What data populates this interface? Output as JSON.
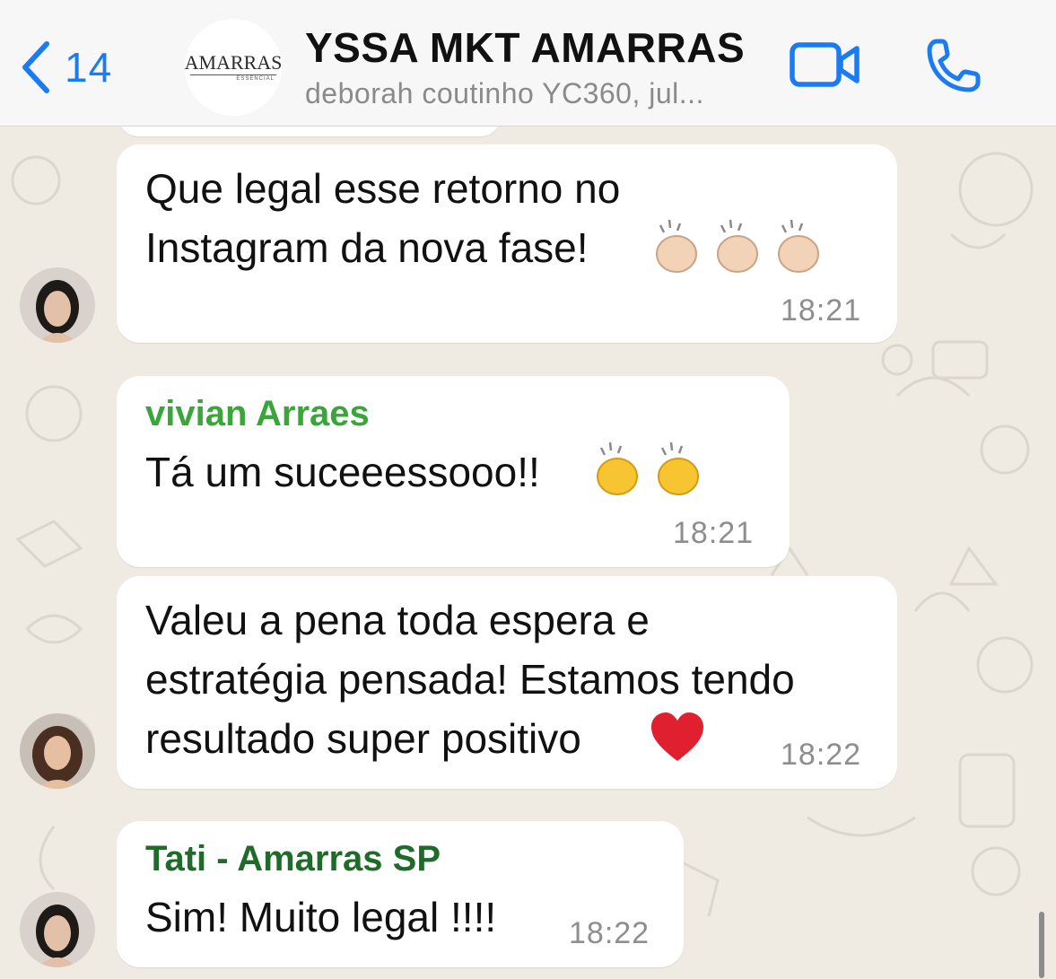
{
  "header": {
    "back_count": "14",
    "group_logo_text": "AMARRAS",
    "group_logo_subtext": "ESSENCIAL",
    "title": "YSSA MKT AMARRAS",
    "subtitle": "deborah coutinho YC360, jul...",
    "icons": {
      "back": "chevron-left-icon",
      "video": "video-camera-icon",
      "call": "phone-icon"
    },
    "accent_color": "#1a7cf0"
  },
  "messages": [
    {
      "sender": "",
      "lines": [
        "Que legal esse retorno no",
        "Instagram da nova fase!"
      ],
      "emoji": "clapping-hands-light-skin x3",
      "time": "18:21"
    },
    {
      "sender": "vivian Arraes",
      "sender_color": "#3aa63a",
      "lines": [
        "Tá um suceeessooo!!"
      ],
      "emoji": "clapping-hands x2",
      "time": "18:21"
    },
    {
      "sender": "",
      "lines": [
        "Valeu a pena toda espera e",
        "estratégia pensada! Estamos tendo",
        "resultado super positivo"
      ],
      "emoji": "red-heart",
      "time": "18:22"
    },
    {
      "sender": "Tati - Amarras SP",
      "sender_color": "#1f6b2a",
      "lines": [
        "Sim! Muito legal !!!!"
      ],
      "emoji": "",
      "time": "18:22"
    }
  ]
}
